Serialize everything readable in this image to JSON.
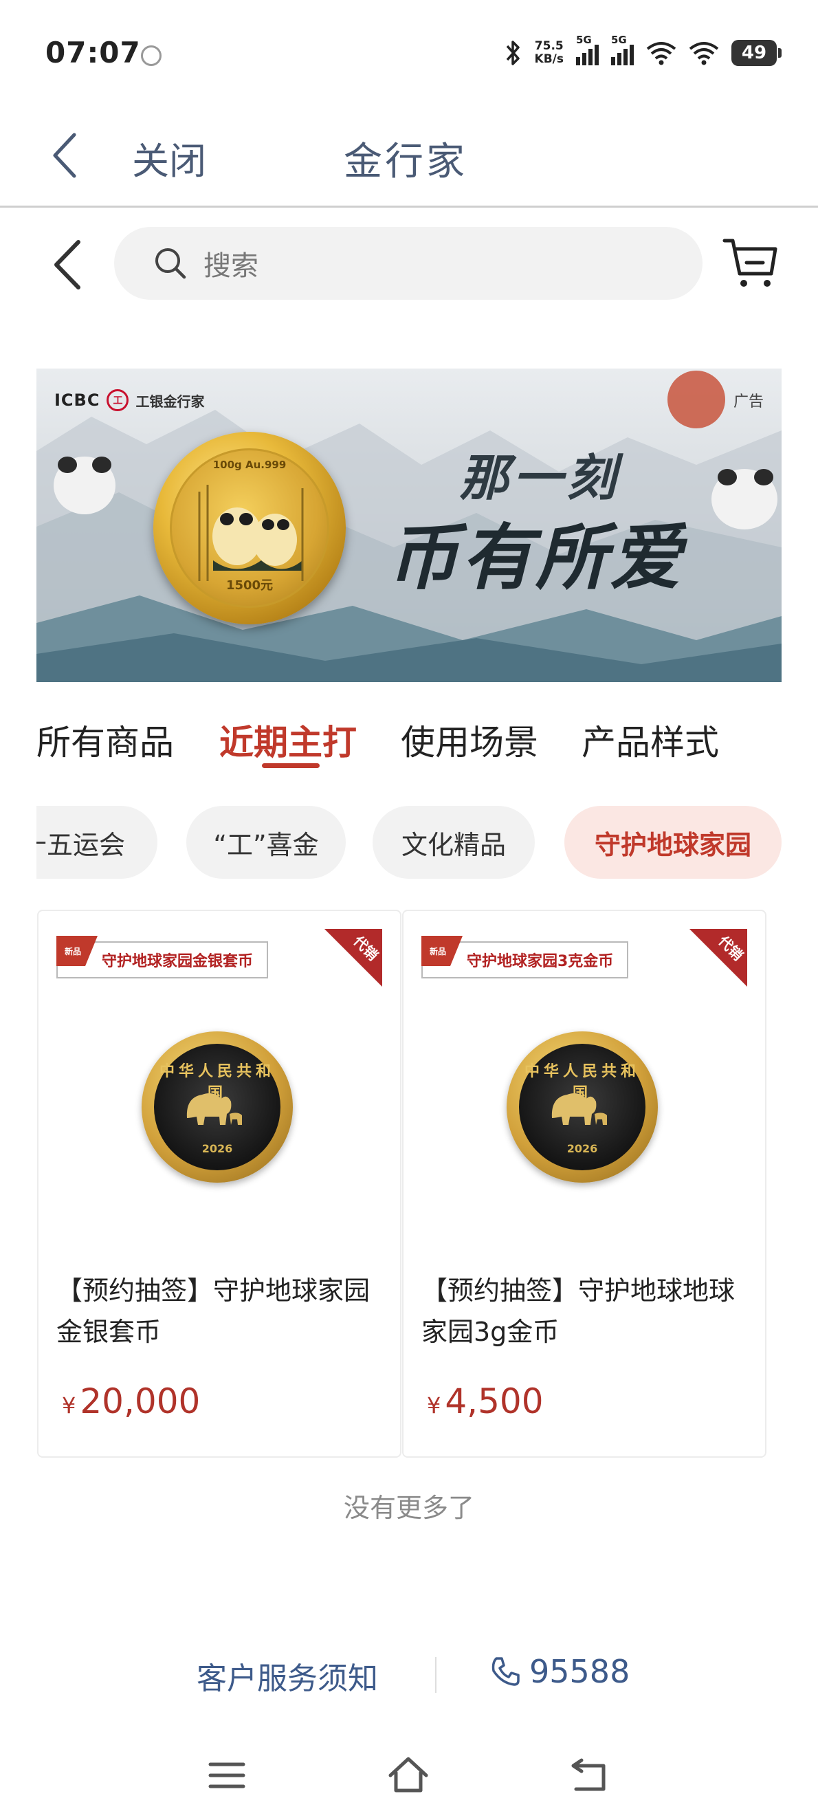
{
  "status_bar": {
    "time": "07:07",
    "net_speed_value": "75.5",
    "net_speed_unit": "KB/s",
    "sim1": "5G",
    "sim2": "5G",
    "battery": "49"
  },
  "titlebar": {
    "close_label": "关闭",
    "title": "金行家"
  },
  "search": {
    "placeholder": "搜索"
  },
  "banner": {
    "brand_en": "ICBC",
    "brand_cn": "工银金行家",
    "ad_label": "广告",
    "slogan_line1": "那一刻",
    "slogan_line2": "币有所爱",
    "coin_top_text": "100g Au.999",
    "coin_value": "1500元"
  },
  "tabs": [
    {
      "label": "所有商品",
      "active": false
    },
    {
      "label": "近期主打",
      "active": true
    },
    {
      "label": "使用场景",
      "active": false
    },
    {
      "label": "产品样式",
      "active": false
    }
  ],
  "chips": [
    {
      "label": "十五运会",
      "active": false
    },
    {
      "label": "“工”喜金",
      "active": false
    },
    {
      "label": "文化精品",
      "active": false
    },
    {
      "label": "守护地球家园",
      "active": true
    }
  ],
  "products": [
    {
      "tag_flag": "新品",
      "tag_label": "守护地球家园金银套币",
      "corner_badge": "代销",
      "coin_rim": "中华人民共和国",
      "coin_year": "2026",
      "title": "【预约抽签】守护地球家园金银套币",
      "currency": "¥",
      "price": "20,000"
    },
    {
      "tag_flag": "新品",
      "tag_label": "守护地球家园3克金币",
      "corner_badge": "代销",
      "coin_rim": "中华人民共和国",
      "coin_year": "2026",
      "title": "【预约抽签】守护地球地球家园3g金币",
      "currency": "¥",
      "price": "4,500"
    }
  ],
  "list_end_text": "没有更多了",
  "footer": {
    "service_notice": "客户服务须知",
    "phone": "95588"
  },
  "colors": {
    "accent": "#c0392b",
    "link": "#3d5a8a",
    "chip_bg": "#f2f2f2",
    "chip_active_bg": "#fbe7e3"
  }
}
